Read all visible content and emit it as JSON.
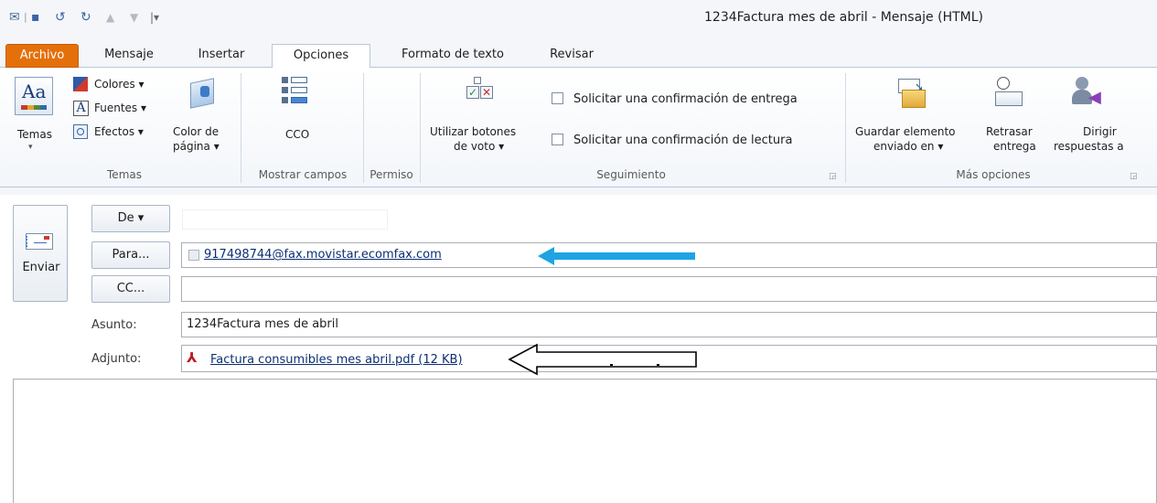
{
  "window": {
    "title": "1234Factura mes de abril  -  Mensaje (HTML)"
  },
  "tabs": [
    {
      "label": "Archivo"
    },
    {
      "label": "Mensaje"
    },
    {
      "label": "Insertar"
    },
    {
      "label": "Opciones"
    },
    {
      "label": "Formato de texto"
    },
    {
      "label": "Revisar"
    }
  ],
  "ribbon": {
    "temas": {
      "temas_label": "Temas",
      "colores": "Colores ▾",
      "fuentes": "Fuentes ▾",
      "efectos": "Efectos ▾",
      "color_pagina_1": "Color de",
      "color_pagina_2": "página ▾",
      "group": "Temas"
    },
    "mostrar": {
      "cco": "CCO",
      "group": "Mostrar campos"
    },
    "permiso": {
      "group": "Permiso"
    },
    "seguimiento": {
      "votar_1": "Utilizar botones",
      "votar_2": "de voto ▾",
      "entrega": "Solicitar una confirmación de entrega",
      "lectura": "Solicitar una confirmación de lectura",
      "group": "Seguimiento"
    },
    "mas": {
      "guardar_1": "Guardar elemento",
      "guardar_2": "enviado en ▾",
      "retrasar_1": "Retrasar",
      "retrasar_2": "entrega",
      "dirigir_1": "Dirigir",
      "dirigir_2": "respuestas a",
      "group": "Más opciones"
    }
  },
  "compose": {
    "send": "Enviar",
    "from_btn": "De ▾",
    "to_btn": "Para...",
    "cc_btn": "CC...",
    "subject_label": "Asunto:",
    "attach_label": "Adjunto:",
    "to_value": "917498744@fax.movistar.ecomfax.com",
    "cc_value": "",
    "subject_value": "1234Factura mes de abril",
    "attachment": "Factura consumibles mes abril.pdf (12 KB)"
  },
  "colors": {
    "file_tab": "#e4700a",
    "arrow_blue": "#1fa3e3",
    "accent_border": "#b8c7d9"
  }
}
